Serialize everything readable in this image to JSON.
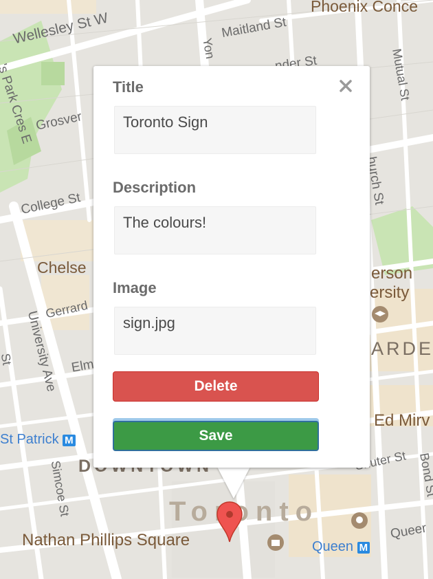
{
  "map": {
    "streets": {
      "wellesley": "Wellesley St W",
      "maitland": "Maitland St",
      "alexander": "nder St",
      "mutual": "Mutual St",
      "grosvenor": "Grosver",
      "queens_park": "'s Park Cres E",
      "college": "College St",
      "church": "hurch St",
      "gerrard": "Gerrard",
      "university": "University Ave",
      "elm": "Elm",
      "simcoe": "Simcoe St",
      "shuter": "Shuter St",
      "bond": "Bond St",
      "queen_st": "Queer",
      "st_left": "St",
      "yonge": "Yon"
    },
    "places": {
      "phoenix": "Phoenix Conce",
      "chelsea": "Chelse",
      "ryerson_1": "erson",
      "ryerson_2": "ersity",
      "garden": "ARDE",
      "ed_mirvish": "Ed Mirv",
      "downtown": "DOWNTOWN",
      "toronto": "Toronto",
      "nathan_phillips": "Nathan Phillips Square",
      "st_patrick_station": "St Patrick",
      "queen_station": "Queen",
      "metro_badge": "M"
    }
  },
  "popup": {
    "close_icon": "close-icon",
    "title_label": "Title",
    "title_value": "Toronto Sign",
    "description_label": "Description",
    "description_value": "The colours!",
    "image_label": "Image",
    "image_value": "sign.jpg",
    "delete_label": "Delete",
    "save_label": "Save"
  },
  "colors": {
    "delete": "#d9534f",
    "save": "#3c9a45",
    "pin": "#ef5350",
    "map_bg": "#e8e6e1"
  }
}
